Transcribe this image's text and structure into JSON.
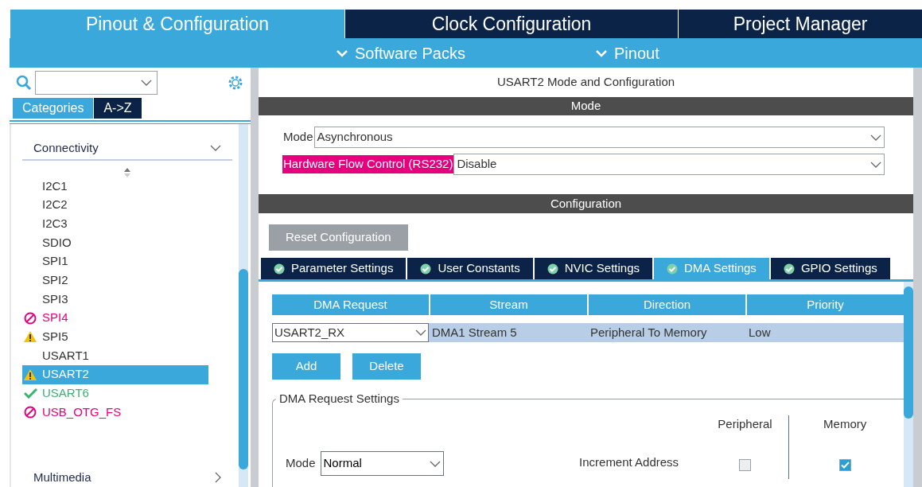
{
  "main_tabs": [
    {
      "label": "Pinout & Configuration",
      "selected": true
    },
    {
      "label": "Clock Configuration",
      "selected": false
    },
    {
      "label": "Project Manager",
      "selected": false
    }
  ],
  "sub_menus": [
    {
      "label": "Software Packs"
    },
    {
      "label": "Pinout"
    }
  ],
  "sidebar": {
    "view_tabs": [
      {
        "label": "Categories",
        "selected": true
      },
      {
        "label": "A->Z",
        "selected": false
      }
    ],
    "category": {
      "label": "Connectivity",
      "expanded": true
    },
    "items": [
      {
        "label": "I2C1",
        "kind": "plain",
        "selected": false
      },
      {
        "label": "I2C2",
        "kind": "plain",
        "selected": false
      },
      {
        "label": "I2C3",
        "kind": "plain",
        "selected": false
      },
      {
        "label": "SDIO",
        "kind": "plain",
        "selected": false
      },
      {
        "label": "SPI1",
        "kind": "plain",
        "selected": false
      },
      {
        "label": "SPI2",
        "kind": "plain",
        "selected": false
      },
      {
        "label": "SPI3",
        "kind": "plain",
        "selected": false
      },
      {
        "label": "SPI4",
        "kind": "blocked",
        "selected": false
      },
      {
        "label": "SPI5",
        "kind": "warning",
        "selected": false
      },
      {
        "label": "USART1",
        "kind": "plain",
        "selected": false
      },
      {
        "label": "USART2",
        "kind": "warning",
        "selected": true
      },
      {
        "label": "USART6",
        "kind": "ok",
        "selected": false
      },
      {
        "label": "USB_OTG_FS",
        "kind": "blocked",
        "selected": false
      }
    ],
    "next_category": {
      "label": "Multimedia",
      "expanded": false
    }
  },
  "panel": {
    "title": "USART2 Mode and Configuration",
    "mode_section": {
      "title": "Mode",
      "fields": [
        {
          "label": "Mode",
          "value": "Asynchronous",
          "highlighted": false
        },
        {
          "label": "Hardware Flow Control (RS232)",
          "value": "Disable",
          "highlighted": true
        }
      ]
    },
    "config_section": {
      "title": "Configuration",
      "reset_button": "Reset Configuration",
      "tabs": [
        {
          "label": "Parameter Settings",
          "selected": false
        },
        {
          "label": "User Constants",
          "selected": false
        },
        {
          "label": "NVIC Settings",
          "selected": false
        },
        {
          "label": "DMA Settings",
          "selected": true
        },
        {
          "label": "GPIO Settings",
          "selected": false
        }
      ],
      "table": {
        "columns": [
          "DMA Request",
          "Stream",
          "Direction",
          "Priority"
        ],
        "rows": [
          {
            "cells": [
              "USART2_RX",
              "DMA1 Stream 5",
              "Peripheral To Memory",
              "Low"
            ],
            "selected": true
          }
        ]
      },
      "buttons": [
        "Add",
        "Delete"
      ],
      "request_settings": {
        "title": "DMA Request Settings",
        "mode": {
          "label": "Mode",
          "value": "Normal"
        },
        "column_headers": [
          "Peripheral",
          "Memory"
        ],
        "increment": {
          "label": "Increment Address",
          "peripheral": false,
          "memory": true
        }
      }
    }
  }
}
